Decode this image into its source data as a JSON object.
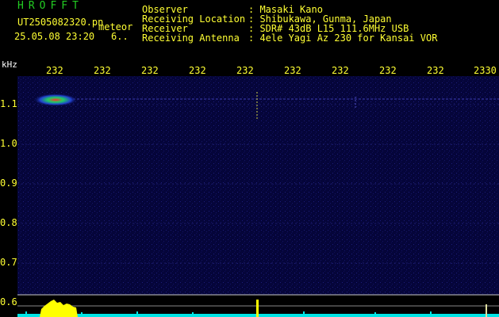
{
  "header": {
    "title": "HROFFT",
    "filename": "UT2505082320.pn",
    "meteor_label": "meteor",
    "datetime": "25.05.08 23:20",
    "count": "6.."
  },
  "info": [
    {
      "label": "Observer",
      "value": ": Masaki Kano"
    },
    {
      "label": "Receiving Location",
      "value": ": Shibukawa, Gunma, Japan"
    },
    {
      "label": "Receiver",
      "value": ": SDR# 43dB L15 111.6MHz USB"
    },
    {
      "label": "Receiving Antenna",
      "value": ": 4ele Yagi Az 230 for Kansai VOR"
    }
  ],
  "axes": {
    "y_unit": "kHz",
    "x_ticks": [
      "232",
      "232",
      "232",
      "232",
      "232",
      "232",
      "232",
      "232",
      "232",
      "2330"
    ],
    "y_ticks": [
      "1.1",
      "1.0",
      "0.9",
      "0.8",
      "0.7",
      "0.6"
    ]
  },
  "colors": {
    "background": "#000000",
    "header_title": "#22cc22",
    "label_text": "#ffff33",
    "spectrogram_bg": "#05053a",
    "spectrum_bar": "#00e5e5",
    "peak": "#ffff00"
  }
}
